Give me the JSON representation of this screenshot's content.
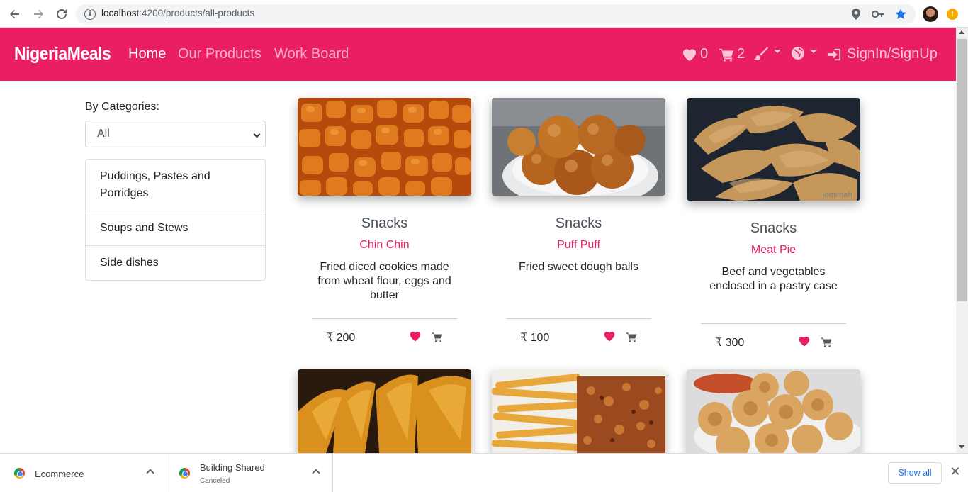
{
  "browser": {
    "url_host": "localhost",
    "url_path": ":4200/products/all-products"
  },
  "navbar": {
    "brand": "NigeriaMeals",
    "links": [
      "Home",
      "Our Products",
      "Work Board"
    ],
    "favorites_count": "0",
    "cart_count": "2",
    "signin_label": "SignIn/SignUp"
  },
  "sidebar": {
    "label": "By Categories:",
    "selected": "All",
    "categories": [
      "Puddings, Pastes and Porridges",
      "Soups and Stews",
      "Side dishes"
    ]
  },
  "products": [
    {
      "category": "Snacks",
      "name": "Chin Chin",
      "description": "Fried diced cookies made from wheat flour, eggs and butter",
      "price": "₹ 200"
    },
    {
      "category": "Snacks",
      "name": "Puff Puff",
      "description": "Fried sweet dough balls",
      "price": "₹ 100"
    },
    {
      "category": "Snacks",
      "name": "Meat Pie",
      "description": "Beef and vegetables enclosed in a pastry case",
      "price": "₹ 300"
    }
  ],
  "watermark": "jemimah",
  "downloads": [
    {
      "name": "Ecommerce",
      "status": ""
    },
    {
      "name": "Building Shared",
      "status": "Canceled"
    }
  ],
  "show_all_label": "Show all",
  "colors": {
    "brand": "#e91e63",
    "accent_link": "#1a73e8"
  }
}
